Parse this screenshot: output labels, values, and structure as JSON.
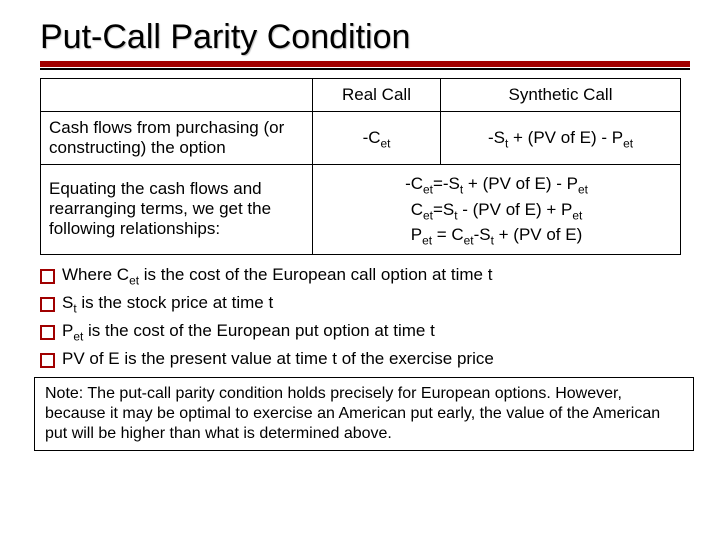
{
  "title": "Put-Call Parity Condition",
  "table": {
    "headers": {
      "blank": "",
      "real": "Real Call",
      "synth": "Synthetic Call"
    },
    "row1": {
      "label": "Cash flows from purchasing (or constructing) the option",
      "real_html": "-C<sub>et</sub>",
      "synth_html": "-S<sub>t</sub> + (PV of E) - P<sub>et</sub>"
    },
    "row2": {
      "label": "Equating the cash flows and rearranging terms, we get the following relationships:",
      "eq1_html": "-C<sub>et</sub>=-S<sub>t</sub> + (PV of E) - P<sub>et</sub>",
      "eq2_html": "C<sub>et</sub>=S<sub>t</sub> - (PV of E) + P<sub>et</sub>",
      "eq3_html": "P<sub>et</sub> = C<sub>et</sub>-S<sub>t</sub> + (PV of E)"
    }
  },
  "bullets": {
    "b1_html": "Where C<sub>et</sub> is the cost of the European call option at time t",
    "b2_html": "S<sub>t</sub> is the stock price at time t",
    "b3_html": "P<sub>et</sub> is the cost of the European put option at time t",
    "b4_html": "PV of E is the present value at time t of the exercise price"
  },
  "note": "Note: The put-call parity condition holds precisely for European options. However, because it may be optimal to exercise an American put early, the value of the American put will be higher than what is determined above."
}
